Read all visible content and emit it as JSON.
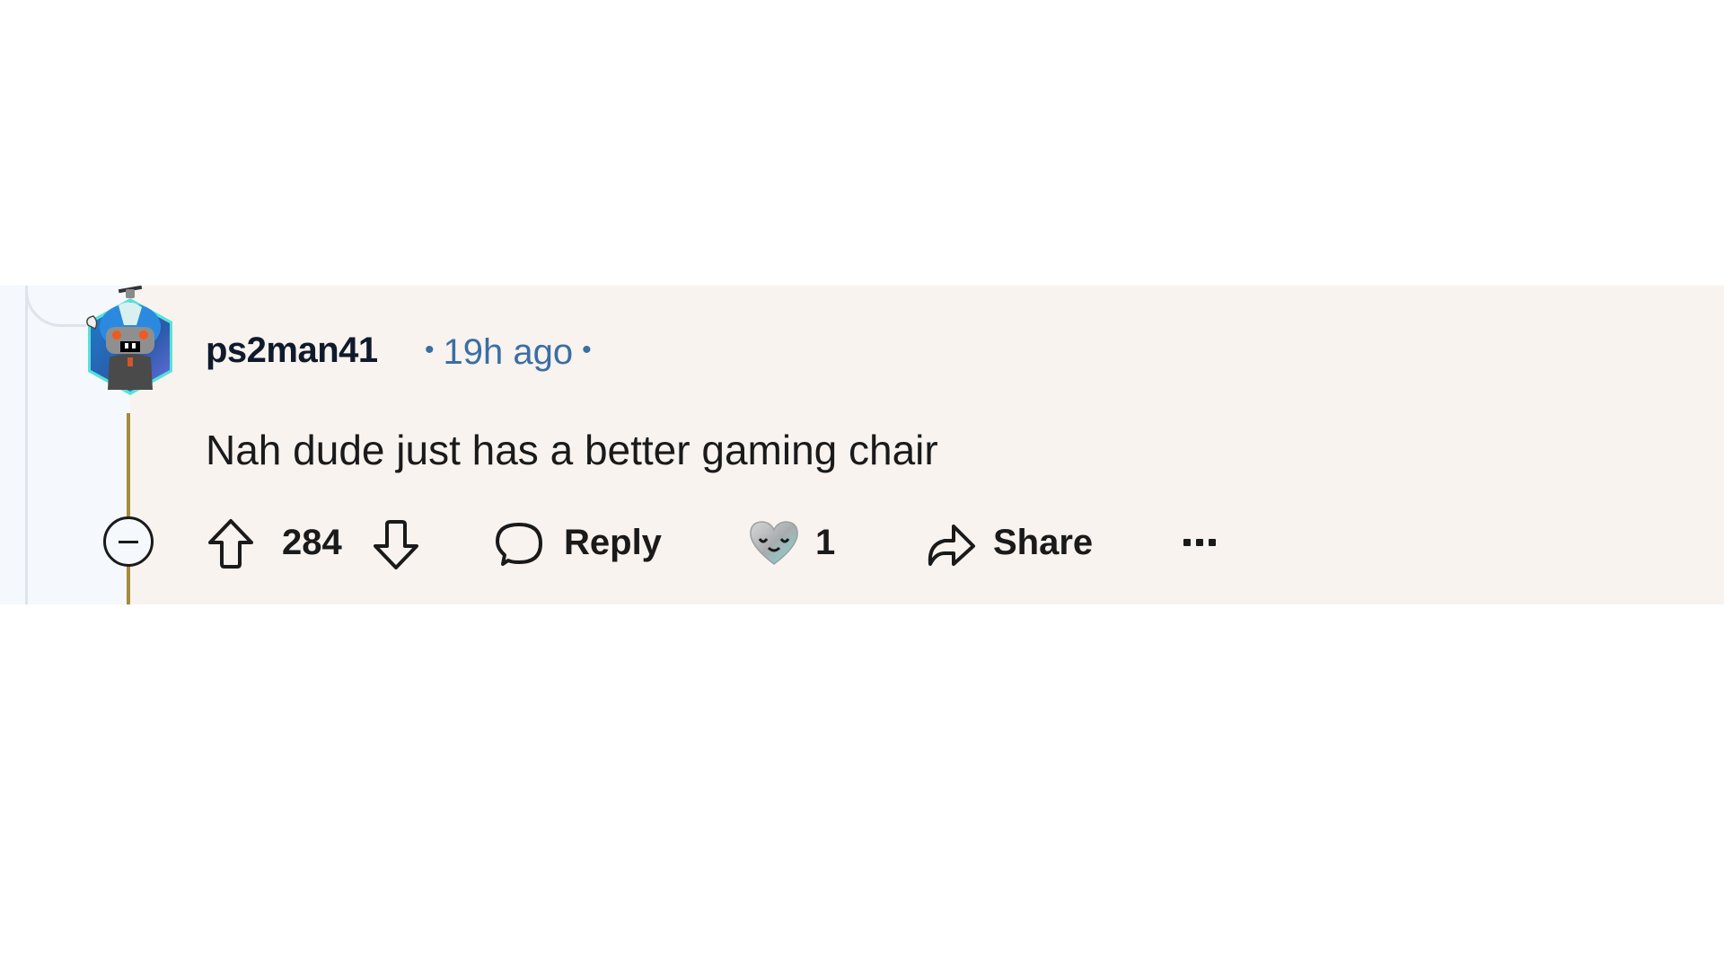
{
  "comment": {
    "author": "ps2man41",
    "timestamp": "19h ago",
    "separator": "•",
    "body": "Nah dude just has a better gaming chair",
    "score": "284",
    "awards_count": "1",
    "actions": {
      "reply_label": "Reply",
      "share_label": "Share",
      "more_label": "···"
    },
    "icons": {
      "avatar": "snoo-avatar-hexagon",
      "upvote": "arrow-up-outline",
      "downvote": "arrow-down-outline",
      "reply": "speech-bubble",
      "award": "silver-heart-award",
      "share": "share-arrow",
      "more": "ellipsis",
      "collapse": "minus-circle"
    }
  },
  "colors": {
    "band_background": "#f8f3ee",
    "thread_gutter": "#f5f8fc",
    "thread_line_active": "#a48a3c",
    "timestamp": "#3a6ea5",
    "text": "#1a1a1b"
  }
}
